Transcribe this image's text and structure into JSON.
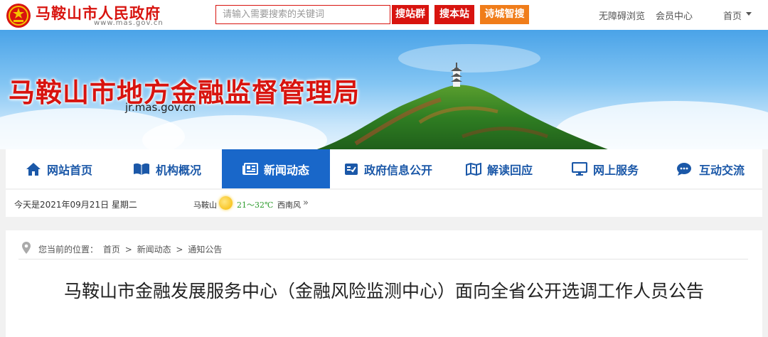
{
  "header": {
    "site_name": "马鞍山市人民政府",
    "site_url": "www.mas.gov.cn",
    "search_placeholder": "请输入需要搜索的关键词",
    "btn_site_group": "搜站群",
    "btn_this_site": "搜本站",
    "btn_smart": "诗城智搜",
    "accessibility": "无障碍浏览",
    "member_center": "会员中心",
    "home": "首页"
  },
  "banner": {
    "title": "马鞍山市地方金融监督管理局",
    "url": "jr.mas.gov.cn"
  },
  "nav": {
    "items": [
      {
        "label": "网站首页",
        "icon": "home-icon"
      },
      {
        "label": "机构概况",
        "icon": "book-icon"
      },
      {
        "label": "新闻动态",
        "icon": "newspaper-icon"
      },
      {
        "label": "政府信息公开",
        "icon": "document-icon"
      },
      {
        "label": "解读回应",
        "icon": "map-icon"
      },
      {
        "label": "网上服务",
        "icon": "monitor-icon"
      },
      {
        "label": "互动交流",
        "icon": "chat-icon"
      }
    ],
    "active": "新闻动态"
  },
  "info": {
    "date": "今天是2021年09月21日 星期二",
    "city": "马鞍山",
    "weather_icon": "sun-icon",
    "temperature": "21～32℃",
    "wind": "西南风"
  },
  "breadcrumb": {
    "prefix": "您当前的位置：",
    "items": [
      "首页",
      ">",
      "新闻动态",
      ">",
      "通知公告"
    ]
  },
  "article": {
    "title": "马鞍山市金融发展服务中心（金融风险监测中心）面向全省公开选调工作人员公告"
  },
  "colors": {
    "brand_red": "#d8140f",
    "nav_blue": "#1b58a8",
    "nav_active_bg": "#1967c9",
    "smart_search_orange": "#f07d1a"
  }
}
